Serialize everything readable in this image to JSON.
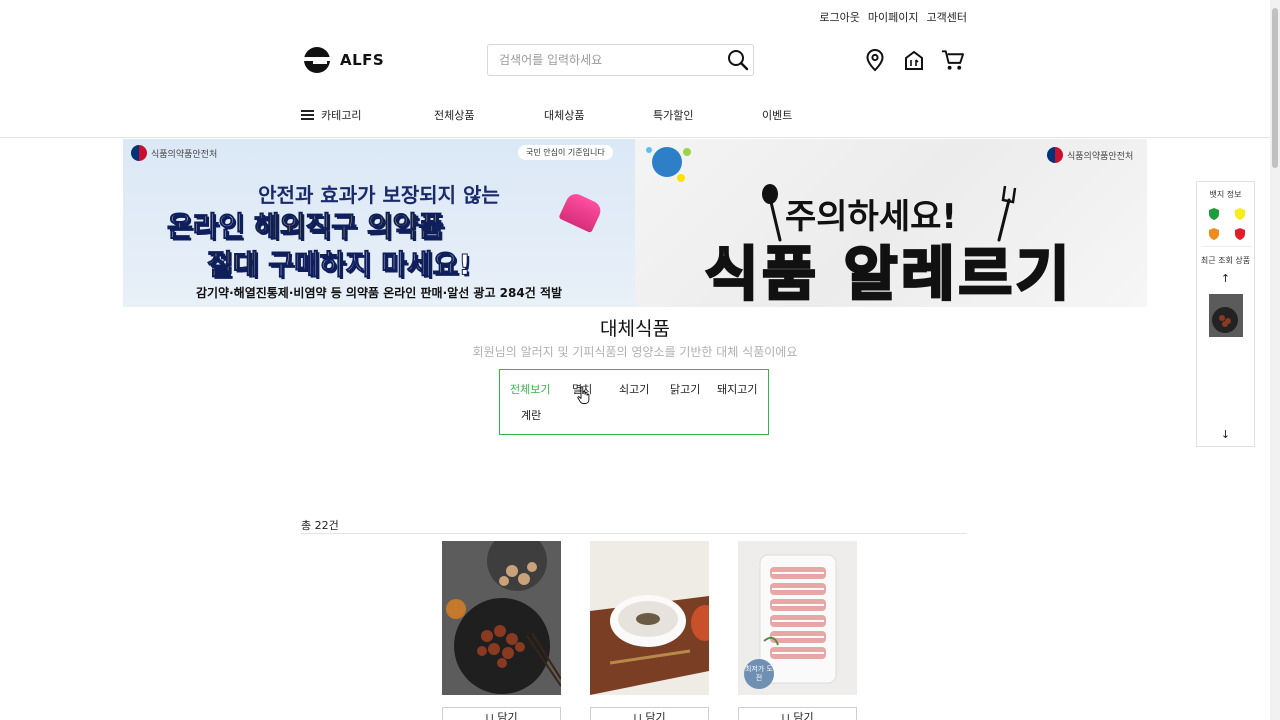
{
  "util_links": {
    "logout": "로그아웃",
    "mypage": "마이페이지",
    "support": "고객센터"
  },
  "logo": {
    "text": "ALFS"
  },
  "search": {
    "placeholder": "검색어를 입력하세요"
  },
  "header_icons": [
    "location-pin-icon",
    "store-icon",
    "cart-icon"
  ],
  "nav": {
    "category": "카테고리",
    "all": "전체상품",
    "substitute": "대체상품",
    "discount": "특가할인",
    "event": "이벤트"
  },
  "banner_left": {
    "agency": "식품의약품안전처",
    "slogan": "국민 안심이 기준입니다",
    "line1": "안전과 효과가 보장되지 않는",
    "line2_a": "온라인 ",
    "line2_b": "해외직구 의약품",
    "line3_a": "절대",
    "line3_b": " 구매하지 마세요!",
    "line4": "감기약·해열진통제·비염약 등 의약품 온라인 판매·알선 광고 284건 적발"
  },
  "banner_right": {
    "agency": "식품의약품안전처",
    "title1": "주의하세요!",
    "title2": "식품 알레르기"
  },
  "section": {
    "title": "대체식품",
    "subtitle": "회원님의 알러지 및 기피식품의 영양소를 기반한 대체 식품이에요"
  },
  "filters": [
    "전체보기",
    "멸치",
    "쇠고기",
    "닭고기",
    "돼지고기",
    "계란"
  ],
  "active_filter": "전체보기",
  "list": {
    "count": "총 22건",
    "cart_label": "담기",
    "badge": "최저가 도전"
  },
  "side_widget": {
    "badge_title": "뱃지 정보",
    "recent_title": "최근 조회 상품",
    "badge_colors": [
      "#1e9e3a",
      "#f5ee1b",
      "#f08a1d",
      "#e11d2a"
    ]
  },
  "colors": {
    "accent": "#38b34a"
  }
}
